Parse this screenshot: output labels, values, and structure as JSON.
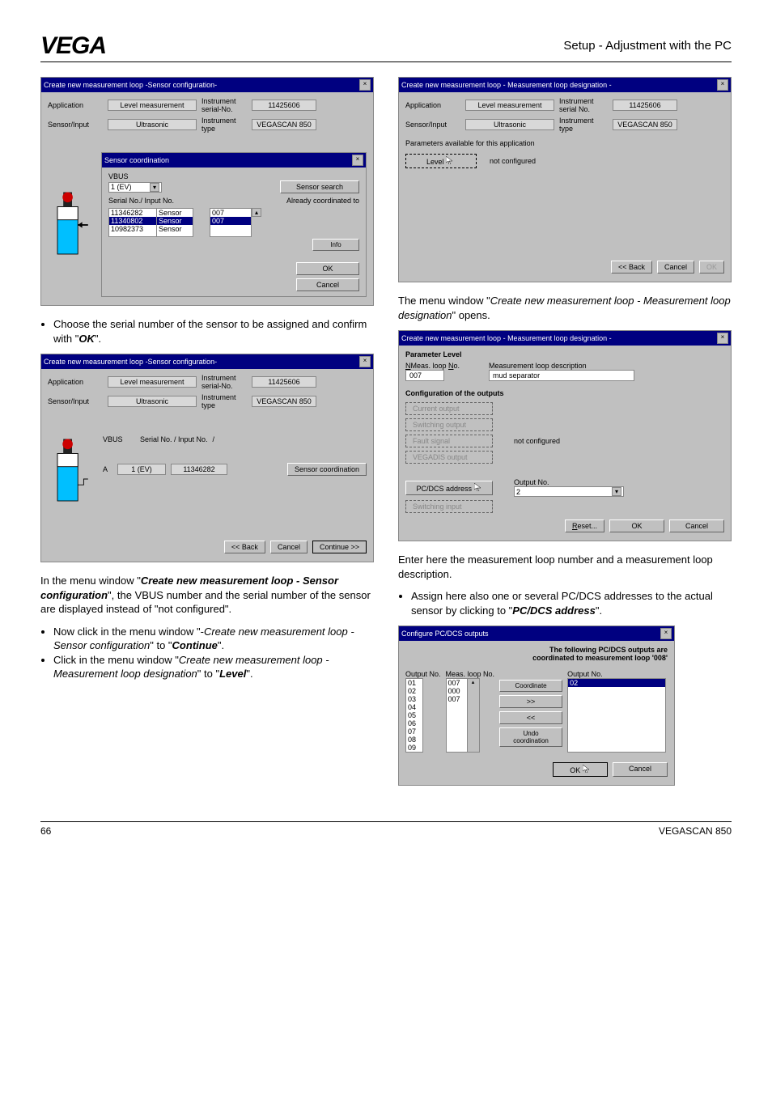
{
  "header": {
    "logo": "VEGA",
    "section": "Setup - Adjustment with the PC"
  },
  "d1": {
    "title": "Create new measurement loop -Sensor configuration-",
    "app_lbl": "Application",
    "app_val": "Level measurement",
    "instr_no_lbl": "Instrument serial-No.",
    "instr_no_val": "11425606",
    "sensor_lbl": "Sensor/Input",
    "sensor_val": "Ultrasonic",
    "instrtype_lbl": "Instrument type",
    "instrtype_val": "VEGASCAN 850",
    "inner_title": "Sensor coordination",
    "vbus": "VBUS",
    "vbus_val": "1  (EV)",
    "search_btn": "Sensor search",
    "serial_lbl": "Serial No./ Input No.",
    "already": "Already coordinated to",
    "r1a": "11346282",
    "r1b": "Sensor",
    "r1c": "007",
    "r2a": "11340802",
    "r2b": "Sensor",
    "r2c": "007",
    "r3a": "10982373",
    "r3b": "Sensor",
    "info": "Info",
    "ok": "OK",
    "cancel": "Cancel"
  },
  "p1": "Choose the serial number of the sensor to be assigned and confirm with \"",
  "p1_ok": "OK",
  "p1_end": "\".",
  "d2": {
    "title": "Create new measurement loop -Sensor configuration-",
    "vbus": "VBUS",
    "serial": "Serial No. / Input No.",
    "slash": "/",
    "a": "A",
    "a_val1": "1  (EV)",
    "a_val2": "11346282",
    "coord_btn": "Sensor coordination",
    "back": "<< Back",
    "cancel": "Cancel",
    "continue": "Continue >>"
  },
  "p2a": "In the menu window \"",
  "p2b": "Create new measurement loop - Sensor configuration",
  "p2c": "\", the VBUS number and the serial number of the sensor are displayed instead of \"not configured\".",
  "b1a": "Now click in the menu window \"-",
  "b1b": "Create new measurement loop - Sensor configuration",
  "b1c": "\" to \"",
  "b1d": "Continue",
  "b1e": "\".",
  "b2a": "Click in the menu window \"",
  "b2b": "Create new measurement loop - Measurement loop designation",
  "b2c": "\" to \"",
  "b2d": "Level",
  "b2e": "\".",
  "d3": {
    "title": "Create new measurement loop - Measurement loop designation -",
    "app_lbl": "Application",
    "app_val": "Level measurement",
    "instr_no_lbl": "Instrument serial No.",
    "instr_no_val": "11425606",
    "sensor_lbl": "Sensor/Input",
    "sensor_val": "Ultrasonic",
    "instrtype_lbl": "Instrument type",
    "instrtype_val": "VEGASCAN 850",
    "params": "Parameters available for this application",
    "level": "Level",
    "notconf": "not configured",
    "back": "<< Back",
    "cancel": "Cancel",
    "ok": "OK"
  },
  "p3a": "The menu window \"",
  "p3b": "Create new measurement loop - Measurement loop designation",
  "p3c": "\" opens.",
  "d4": {
    "title": "Create new measurement loop - Measurement loop designation -",
    "param": "Parameter  Level",
    "mloop_lbl": "Meas. loop No.",
    "mloop_val": "007",
    "desc_lbl": "Measurement loop description",
    "desc_val": "mud  separator",
    "conf": "Configuration of the outputs",
    "co": "Current output",
    "so": "Switching output",
    "fs": "Fault signal",
    "vd": "VEGADIS output",
    "notconf": "not configured",
    "pcdcs": "PC/DCS address",
    "outno": "Output No.",
    "outval": "2",
    "si": "Switching input",
    "reset": "Reset...",
    "ok": "OK",
    "cancel": "Cancel"
  },
  "p4": "Enter here the measurement loop number and a measurement loop description.",
  "b3a": "Assign here also one or several PC/DCS addresses to the actual sensor by clicking to \"",
  "b3b": "PC/DCS address",
  "b3c": "\".",
  "d5": {
    "title": "Configure PC/DCS outputs",
    "heading": "The following PC/DCS outputs are coordinated to measurement loop '008'",
    "outno_l": "Output No.",
    "mloop_l": "Meas. loop No.",
    "outno_r": "Output No.",
    "l01": "01",
    "l02": "02",
    "l03": "03",
    "l04": "04",
    "l05": "05",
    "l06": "06",
    "l07": "07",
    "l08": "08",
    "l09": "09",
    "m01": "007",
    "m02": "000",
    "m03": "007",
    "r02": "02",
    "coord": "Coordinate",
    "fwd": ">>",
    "bck": "<<",
    "undo": "Undo coordination",
    "ok": "OK",
    "cancel": "Cancel"
  },
  "footer": {
    "page": "66",
    "product": "VEGASCAN 850"
  }
}
